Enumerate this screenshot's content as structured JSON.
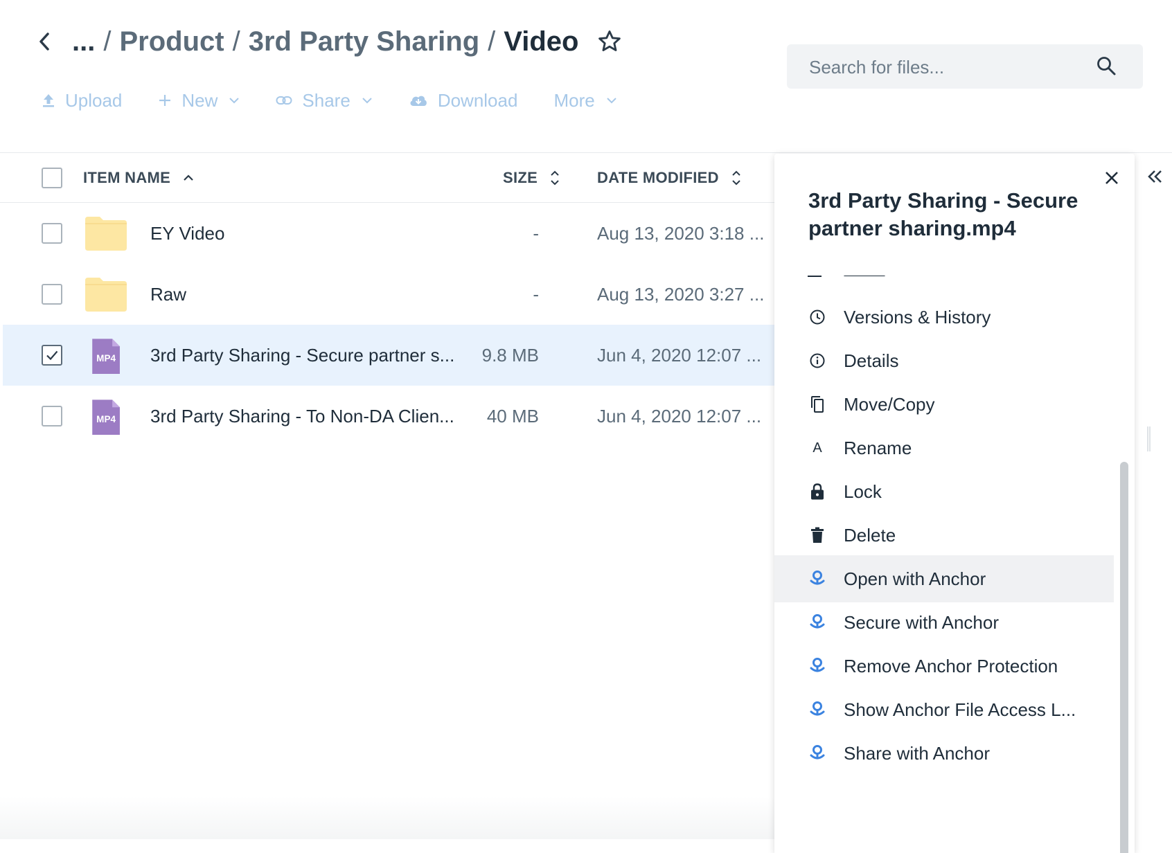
{
  "breadcrumb": {
    "ellipsis": "...",
    "sep": "/",
    "items": [
      "Product",
      "3rd Party Sharing"
    ],
    "current": "Video"
  },
  "toolbar": {
    "upload": "Upload",
    "new": "New",
    "share": "Share",
    "download": "Download",
    "more": "More"
  },
  "search": {
    "placeholder": "Search for files..."
  },
  "list": {
    "headers": {
      "name": "ITEM NAME",
      "size": "SIZE",
      "date": "DATE MODIFIED"
    },
    "rows": [
      {
        "name": "EY Video",
        "size": "-",
        "date": "Aug 13, 2020 3:18 ...",
        "type": "folder",
        "selected": false
      },
      {
        "name": "Raw",
        "size": "-",
        "date": "Aug 13, 2020 3:27 ...",
        "type": "folder",
        "selected": false
      },
      {
        "name": "3rd Party Sharing - Secure partner s...",
        "size": "9.8 MB",
        "date": "Jun 4, 2020 12:07 ...",
        "type": "mp4",
        "badge": "MP4",
        "selected": true
      },
      {
        "name": "3rd Party Sharing - To Non-DA Clien...",
        "size": "40 MB",
        "date": "Jun 4, 2020 12:07 ...",
        "type": "mp4",
        "badge": "MP4",
        "selected": false
      }
    ]
  },
  "panel": {
    "title": "3rd Party Sharing - Secure partner sharing.mp4",
    "menu": [
      {
        "label": "Versions & History",
        "icon": "clock-icon"
      },
      {
        "label": "Details",
        "icon": "info-icon"
      },
      {
        "label": "Move/Copy",
        "icon": "copy-icon"
      },
      {
        "label": "Rename",
        "icon": "rename-icon"
      },
      {
        "label": "Lock",
        "icon": "lock-icon"
      },
      {
        "label": "Delete",
        "icon": "trash-icon"
      },
      {
        "label": "Open with Anchor",
        "icon": "anchor-icon"
      },
      {
        "label": "Secure with Anchor",
        "icon": "anchor-icon"
      },
      {
        "label": "Remove Anchor Protection",
        "icon": "anchor-icon"
      },
      {
        "label": "Show Anchor File Access L...",
        "icon": "anchor-icon"
      },
      {
        "label": "Share with Anchor",
        "icon": "anchor-icon"
      }
    ],
    "rename_glyph": "A"
  },
  "colors": {
    "accent": "#a7c8e8",
    "selected_row": "#e8f2fd",
    "folder": "#fde7a3",
    "mp4": "#9c7cc4",
    "anchor": "#3b83e0"
  }
}
